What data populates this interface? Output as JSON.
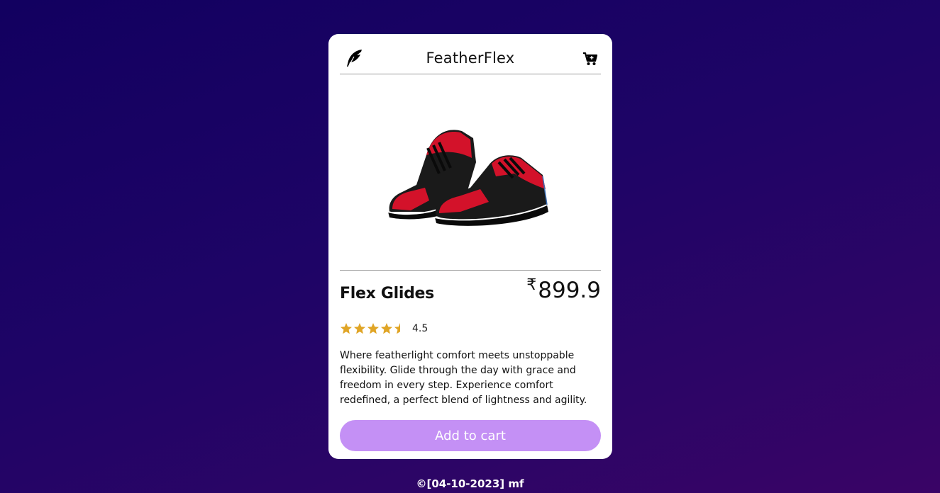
{
  "header": {
    "brand": "FeatherFlex",
    "logo_icon": "feather-icon",
    "cart_icon": "cart-icon"
  },
  "product": {
    "image_alt": "red and black sneakers",
    "name": "Flex Glides",
    "currency": "₹",
    "price": "899.9",
    "rating": 4.5,
    "rating_label": "4.5",
    "description": "Where featherlight comfort meets unstoppable flexibility. Glide through the day with grace and freedom in every step. Experience comfort redefined, a perfect blend of lightness and agility."
  },
  "actions": {
    "add_to_cart_label": "Add to cart"
  },
  "footer": {
    "text": "©[04-10-2023] mf"
  },
  "colors": {
    "background_start": "#120060",
    "background_end": "#3a0466",
    "button": "#c490f5",
    "star": "#e0a526",
    "shoe_red": "#d3122a",
    "shoe_black": "#1a1a1a"
  }
}
